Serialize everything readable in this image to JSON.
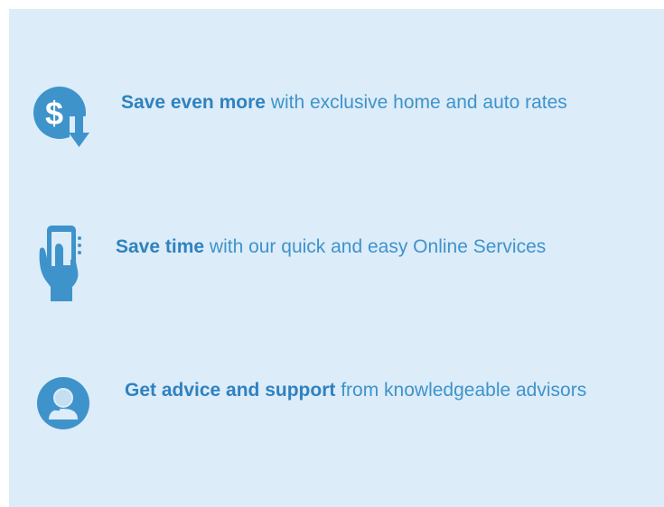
{
  "features": [
    {
      "icon": "dollar-download-icon",
      "bold": "Save even more",
      "rest": " with exclusive home and auto rates"
    },
    {
      "icon": "phone-tap-icon",
      "bold": "Save time",
      "rest": " with our quick and easy Online Services"
    },
    {
      "icon": "advisor-headset-icon",
      "bold": "Get advice and support",
      "rest": " from knowledgeable advisors"
    }
  ],
  "colors": {
    "panel_background": "#dcecf9",
    "accent": "#3f93cb"
  }
}
